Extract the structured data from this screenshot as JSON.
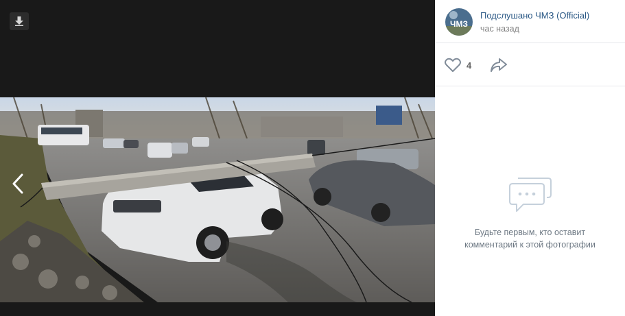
{
  "viewer": {
    "download_icon": "download-arrow-icon",
    "prev_icon": "chevron-left-icon",
    "photo_description": ""
  },
  "post": {
    "author": "Подслушано ЧМЗ (Official)",
    "avatar_text": "ЧМЗ",
    "time": "час назад"
  },
  "actions": {
    "like_icon": "heart-icon",
    "like_count": "4",
    "share_icon": "share-arrow-icon"
  },
  "comments": {
    "empty_icon": "comments-bubble-icon",
    "empty_text": "Будьте первым, кто оставит комментарий к этой фотографии"
  },
  "colors": {
    "link": "#2a5885",
    "muted": "#828282",
    "viewer_bg": "#191919"
  }
}
